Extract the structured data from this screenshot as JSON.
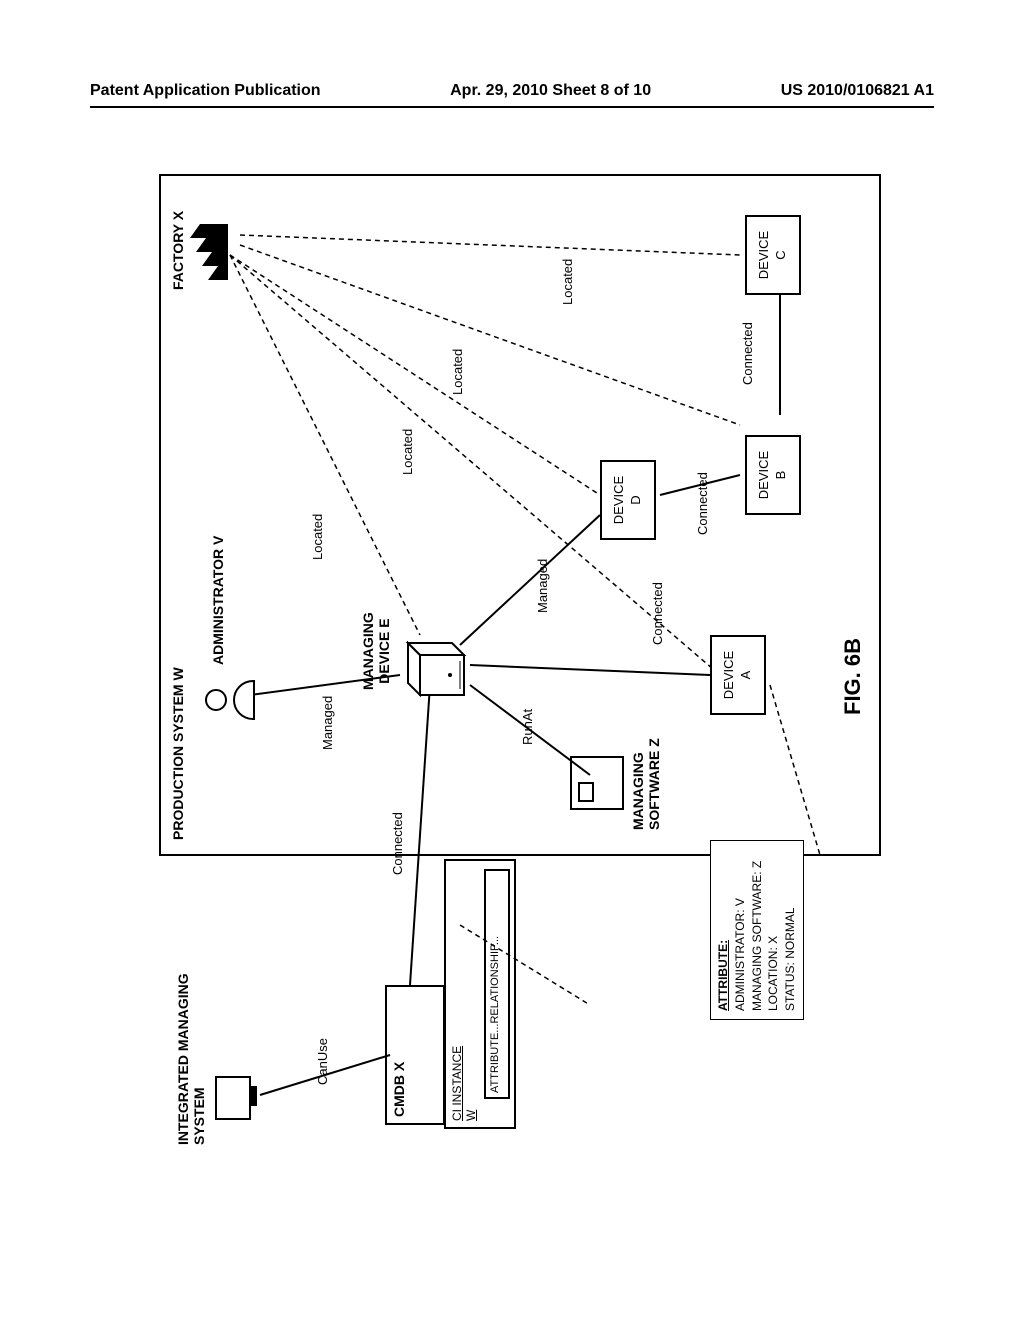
{
  "header": {
    "left": "Patent Application Publication",
    "center": "Apr. 29, 2010  Sheet 8 of 10",
    "right": "US 2010/0106821 A1"
  },
  "figure": {
    "title": "FIG. 6B",
    "labels": {
      "integrated_managing_system": "INTEGRATED MANAGING\nSYSTEM",
      "production_system_w": "PRODUCTION SYSTEM W",
      "cmdb_x": "CMDB X",
      "ci_instance": "CI INSTANCE\nW",
      "attribute_relationship": "ATTRIBUTE...RELATIONSHIP...",
      "administrator_v": "ADMINISTRATOR V",
      "factory_x": "FACTORY X",
      "managing_device_e": "MANAGING\nDEVICE E",
      "managing_software_z": "MANAGING\nSOFTWARE Z",
      "device_a": "DEVICE\nA",
      "device_b": "DEVICE\nB",
      "device_c": "DEVICE\nC",
      "device_d": "DEVICE\nD"
    },
    "relationships": {
      "canuse": "CanUse",
      "connected": "Connected",
      "managed": "Managed",
      "runat": "RunAt",
      "located": "Located"
    },
    "attribute_box": {
      "title": "ATTRIBUTE:",
      "admin": "ADMINISTRATOR: V",
      "software": "MANAGING SOFTWARE: Z",
      "location": "LOCATION: X",
      "status": "STATUS: NORMAL"
    }
  }
}
